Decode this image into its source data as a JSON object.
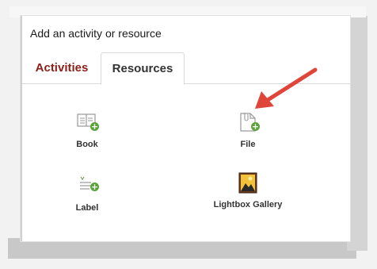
{
  "dialog": {
    "title": "Add an activity or resource",
    "tabs": [
      {
        "label": "Activities",
        "active": false
      },
      {
        "label": "Resources",
        "active": true
      }
    ]
  },
  "resources": [
    {
      "label": "Book",
      "icon": "book-icon"
    },
    {
      "label": "File",
      "icon": "file-icon"
    },
    {
      "label": "Label",
      "icon": "label-icon"
    },
    {
      "label": "Lightbox Gallery",
      "icon": "lightbox-gallery-icon"
    }
  ],
  "colors": {
    "activities_tab": "#8a1f17",
    "plus_badge": "#5aa33a",
    "arrow": "#e0453a"
  }
}
